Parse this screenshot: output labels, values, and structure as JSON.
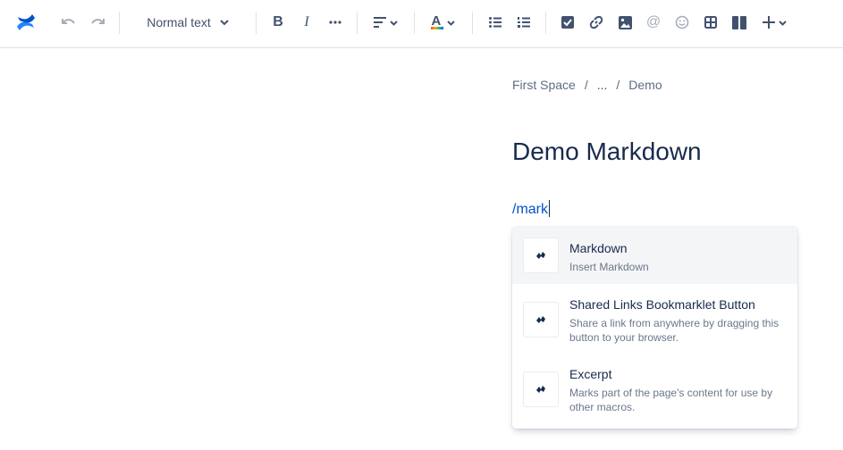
{
  "toolbar": {
    "text_style": "Normal text",
    "icons": [
      "confluence-logo",
      "undo",
      "redo",
      "chevron-down",
      "bold",
      "italic",
      "more",
      "align",
      "text-color",
      "bullet-list",
      "numbered-list",
      "action-item",
      "link",
      "image",
      "mention",
      "emoji",
      "table",
      "layouts",
      "insert"
    ]
  },
  "breadcrumb": {
    "items": [
      "First Space",
      "/",
      "...",
      "/",
      "Demo"
    ]
  },
  "page": {
    "title": "Demo Markdown",
    "command_text": "/mark"
  },
  "menu": {
    "items": [
      {
        "name": "Markdown",
        "description": "Insert Markdown"
      },
      {
        "name": "Shared Links Bookmarklet Button",
        "description": "Share a link from anywhere by dragging this button to your browser."
      },
      {
        "name": "Excerpt",
        "description": "Marks part of the page's content for use by other macros."
      }
    ]
  },
  "colors": {
    "brand": "#2684ff",
    "link": "#0052cc",
    "text": "#172b4d",
    "selected_bg": "#f4f5f7"
  }
}
